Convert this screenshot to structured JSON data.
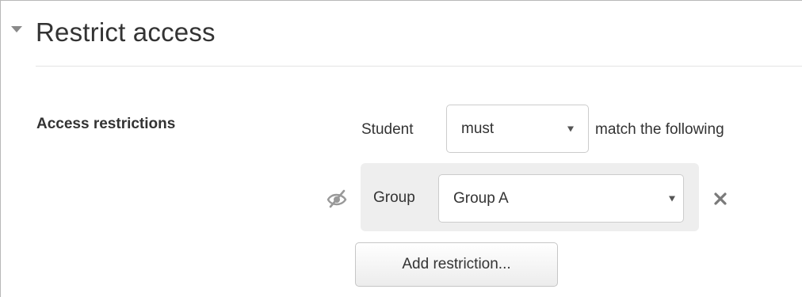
{
  "section": {
    "title": "Restrict access"
  },
  "field": {
    "label": "Access restrictions"
  },
  "restriction_header": {
    "prefix": "Student",
    "selector_value": "must",
    "suffix": "match the following"
  },
  "condition": {
    "type_label": "Group",
    "group_value": "Group A"
  },
  "actions": {
    "add_label": "Add restriction..."
  }
}
